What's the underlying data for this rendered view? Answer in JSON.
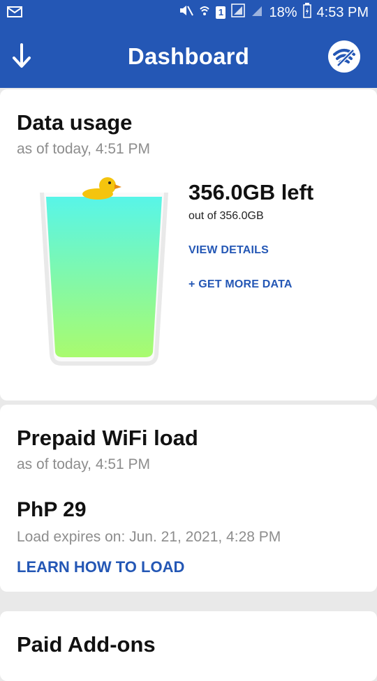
{
  "status_bar": {
    "battery": "18%",
    "time": "4:53 PM",
    "sim_slot": "1"
  },
  "header": {
    "title": "Dashboard"
  },
  "data_usage": {
    "title": "Data usage",
    "as_of": "as of today, 4:51 PM",
    "left": "356.0GB left",
    "out_of": "out of 356.0GB",
    "view_details": "VIEW DETAILS",
    "get_more": "+ GET MORE DATA",
    "remaining_fraction": 1.0
  },
  "prepaid": {
    "title": "Prepaid WiFi load",
    "as_of": "as of today, 4:51 PM",
    "amount": "PhP 29",
    "expires": "Load expires on: Jun. 21, 2021, 4:28 PM",
    "learn": "LEARN HOW TO LOAD"
  },
  "addons": {
    "title": "Paid Add-ons"
  },
  "icons": {
    "status_left": "mail-icon",
    "status_right": [
      "mute-icon",
      "wifi-signal-icon",
      "sim-icon",
      "signal-icon",
      "signal-icon",
      "battery-icon"
    ],
    "header_left": "download-arrow-icon",
    "header_right": "wifi-logo-icon",
    "glass_mascot": "duck-icon"
  },
  "colors": {
    "primary": "#2457b5",
    "link": "#2457b5",
    "glass_top": "#58f5e8",
    "glass_bottom": "#a9fb6e"
  }
}
